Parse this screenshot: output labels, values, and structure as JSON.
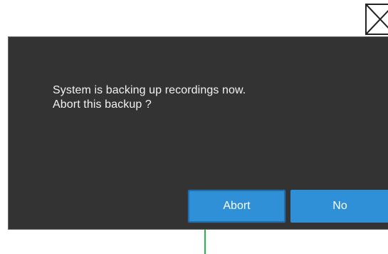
{
  "dialog": {
    "message_line1": "System is backing up recordings now.",
    "message_line2": "Abort this backup ?",
    "abort_label": "Abort",
    "no_label": "No"
  },
  "icons": {
    "close": "close-icon"
  },
  "colors": {
    "dialog_background": "#333333",
    "button_primary": "#2f8fd7",
    "focus_indicator": "#2bb34a",
    "text": "#f2f2f2"
  }
}
